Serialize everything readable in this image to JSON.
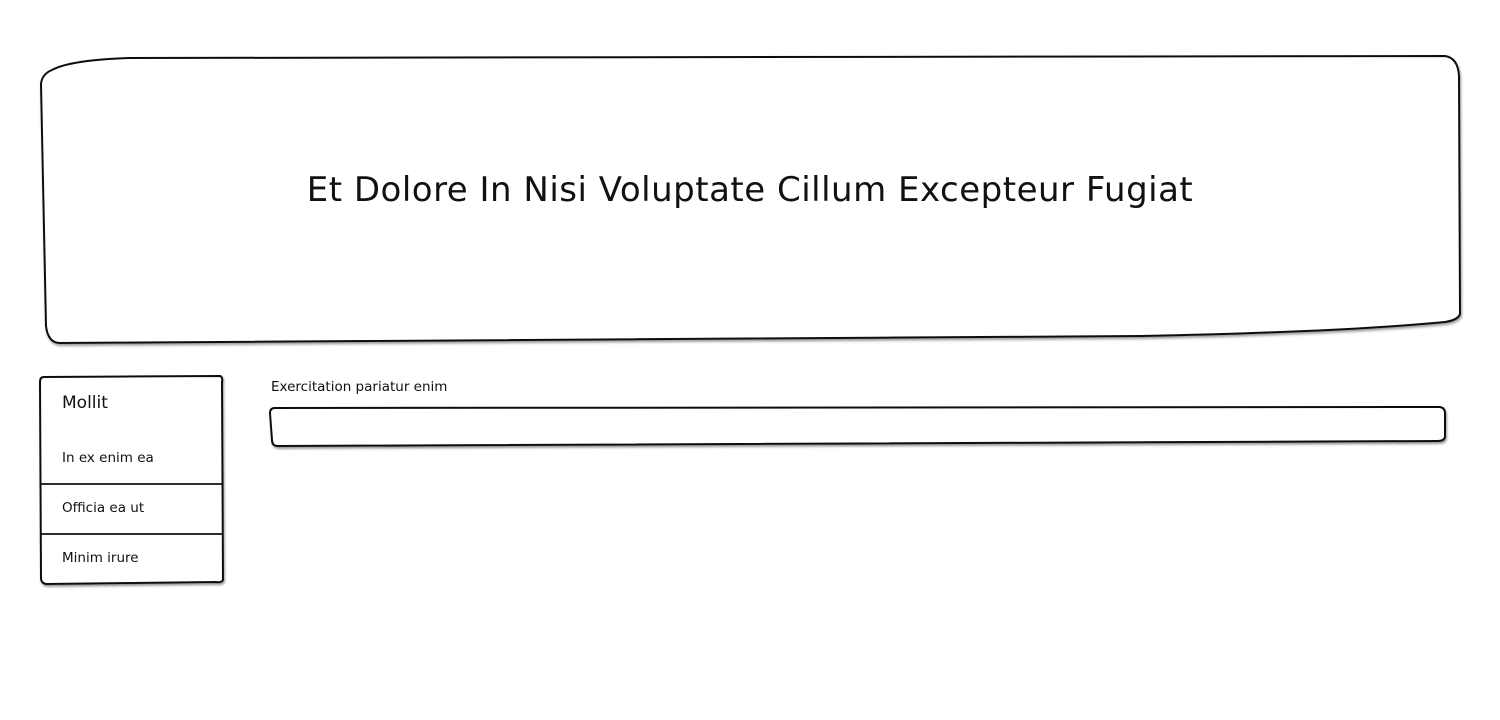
{
  "hero": {
    "title": "Et Dolore In Nisi Voluptate Cillum Excepteur Fugiat"
  },
  "sidebar": {
    "heading": "Mollit",
    "items": [
      {
        "label": "In ex enim ea"
      },
      {
        "label": "Officia ea ut"
      },
      {
        "label": "Minim irure"
      }
    ]
  },
  "main": {
    "field": {
      "label": "Exercitation pariatur enim",
      "value": "",
      "placeholder": ""
    }
  },
  "colors": {
    "background": "#ffffff",
    "ink": "#111111",
    "shadow": "#555555"
  }
}
